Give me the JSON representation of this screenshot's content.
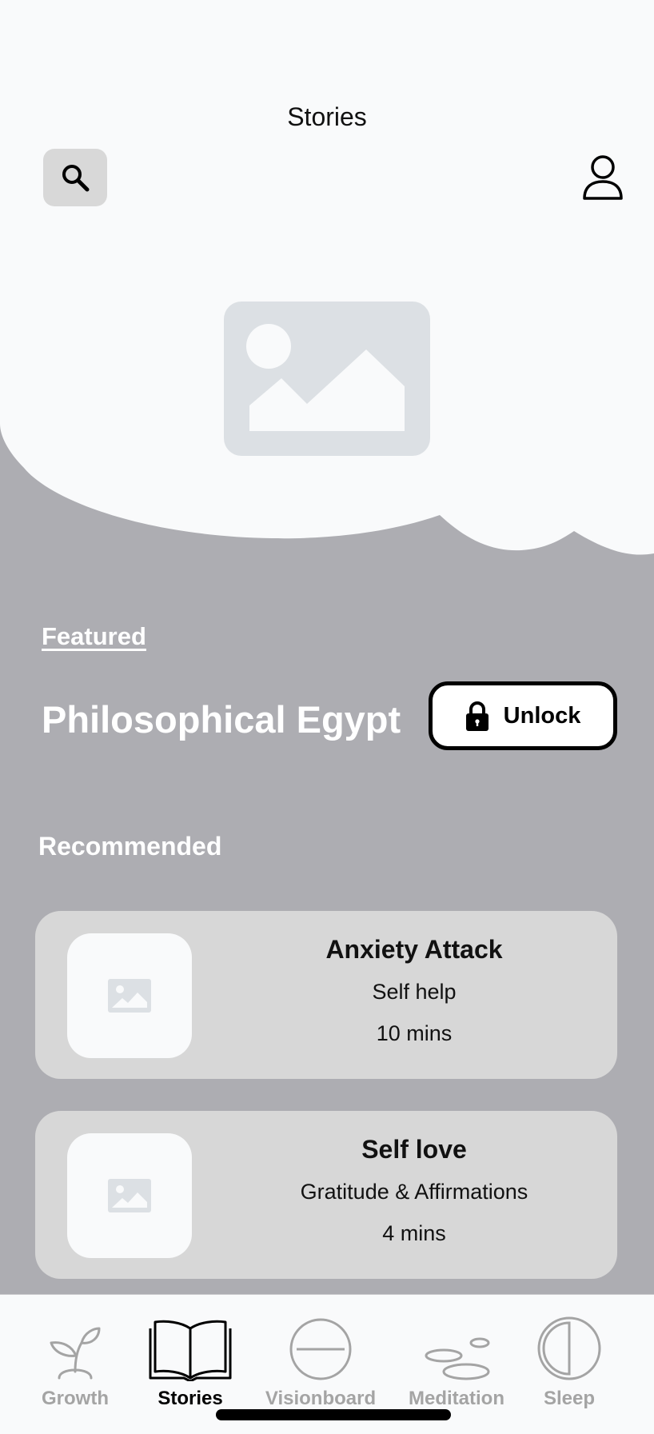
{
  "header": {
    "title": "Stories"
  },
  "featured": {
    "section_label": "Featured",
    "title": "Philosophical Egypt",
    "unlock_label": "Unlock"
  },
  "recommended": {
    "section_title": "Recommended",
    "items": [
      {
        "title": "Anxiety Attack",
        "subtitle": "Self help",
        "duration": "10 mins"
      },
      {
        "title": "Self love",
        "subtitle": "Gratitude & Affirmations",
        "duration": "4 mins"
      }
    ]
  },
  "tabs": [
    {
      "label": "Growth",
      "icon": "sprout-icon",
      "active": false
    },
    {
      "label": "Stories",
      "icon": "open-book-icon",
      "active": true
    },
    {
      "label": "Visionboard",
      "icon": "circle-line-icon",
      "active": false
    },
    {
      "label": "Meditation",
      "icon": "stones-icon",
      "active": false
    },
    {
      "label": "Sleep",
      "icon": "half-moon-icon",
      "active": false
    }
  ],
  "colors": {
    "background": "#adadb2",
    "surface": "#f9fafb",
    "card": "#d7d7d7",
    "placeholder": "#dce0e4",
    "tab_inactive": "#a4a4a4",
    "tab_active": "#000000"
  }
}
